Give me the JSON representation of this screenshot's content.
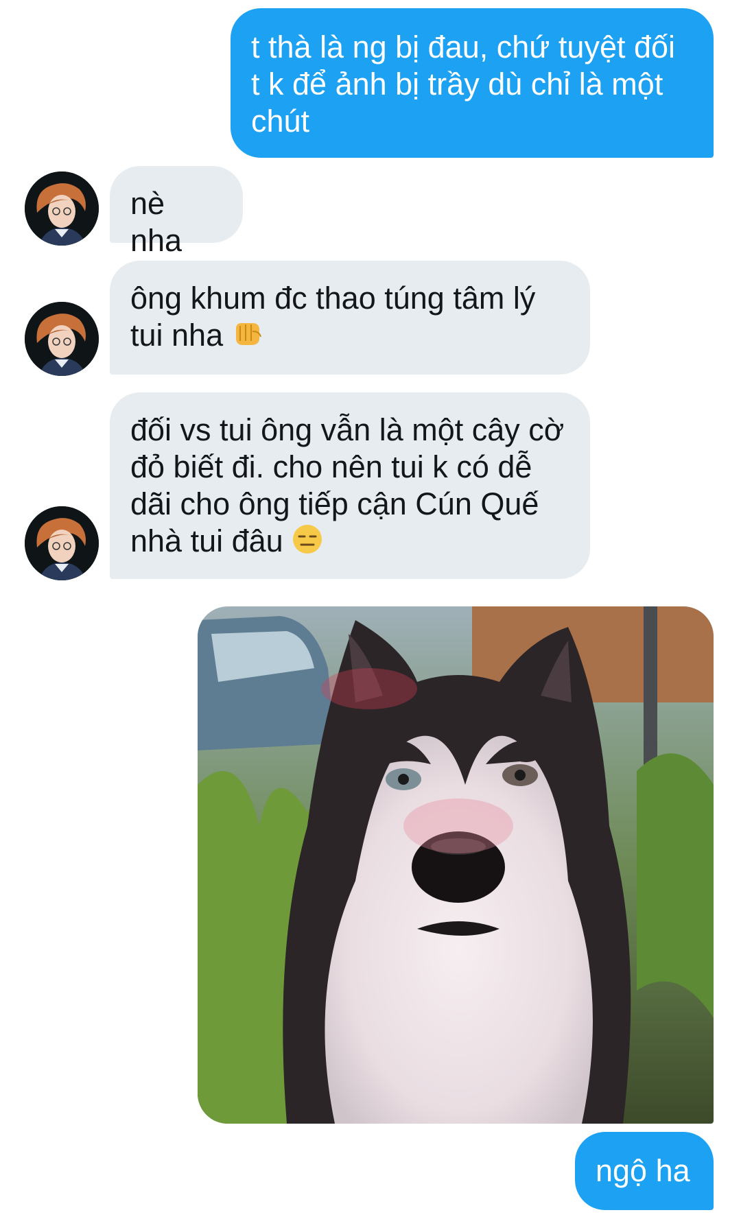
{
  "conversation": {
    "messages": [
      {
        "from": "me",
        "text": "t thà là ng bị đau, chứ tuyệt đối\nt k để ảnh bị trầy dù chỉ là một\nchút"
      },
      {
        "from": "them",
        "text": "nè nha"
      },
      {
        "from": "them",
        "text": "ông khum đc thao túng tâm lý\ntui nha",
        "emoji": "fist-bump-emoji"
      },
      {
        "from": "them",
        "text": "đối vs tui ông vẫn là một cây cờ\nđỏ biết đi. cho nên tui k có dễ\ndãi cho ông tiếp cận Cún Quế\nnhà tui đâu",
        "emoji": "expressionless-face-emoji"
      },
      {
        "from": "me",
        "type": "image",
        "image": "husky-photo"
      },
      {
        "from": "me",
        "text": "ngộ ha"
      }
    ]
  },
  "colors": {
    "outgoing_bubble": "#1da1f2",
    "incoming_bubble": "#e6ecf0",
    "incoming_text": "#14171a",
    "outgoing_text": "#ffffff"
  }
}
